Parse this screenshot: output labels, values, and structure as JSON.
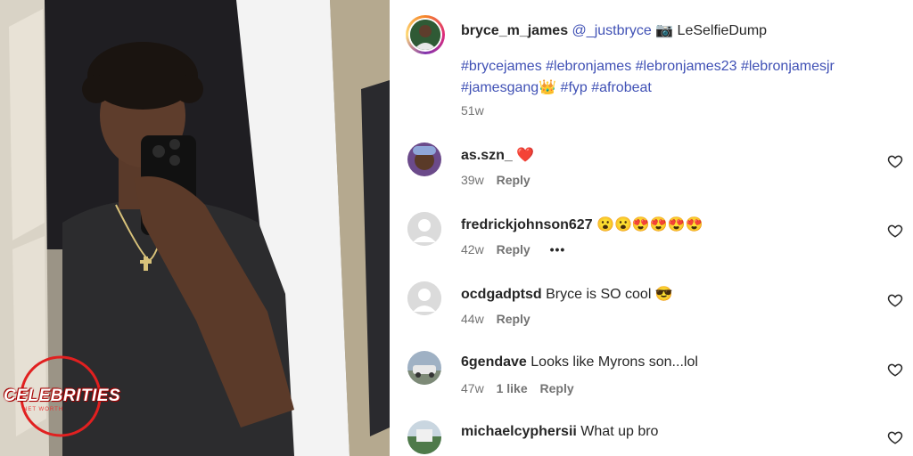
{
  "post": {
    "username": "bryce_m_james",
    "mention": "@_justbryce",
    "camera_emoji": "📷",
    "caption_suffix": "LeSelfieDump",
    "hashtags_line1": "#brycejames #lebronjames #lebronjames23 #lebronjamesjr",
    "hashtags_line2_a": "#jamesgang",
    "crown_emoji": "👑",
    "hashtags_line2_b": "#fyp #afrobeat",
    "age": "51w"
  },
  "watermark": {
    "title": "CELEBRITIES",
    "subtitle": "NET WORTH"
  },
  "comments": [
    {
      "user": "as.szn_",
      "text": "",
      "emoji": "❤️",
      "age": "39w",
      "likes": "",
      "reply": "Reply",
      "more": "",
      "avatar": "photo"
    },
    {
      "user": "fredrickjohnson627",
      "text": "",
      "emoji": "😮😮😍😍😍😍",
      "age": "42w",
      "likes": "",
      "reply": "Reply",
      "more": "•••",
      "avatar": "default"
    },
    {
      "user": "ocdgadptsd",
      "text": "Bryce is SO cool",
      "emoji": "😎",
      "age": "44w",
      "likes": "",
      "reply": "Reply",
      "more": "",
      "avatar": "default"
    },
    {
      "user": "6gendave",
      "text": "Looks like Myrons son...lol",
      "emoji": "",
      "age": "47w",
      "likes": "1 like",
      "reply": "Reply",
      "more": "",
      "avatar": "photo"
    },
    {
      "user": "michaelcyphersii",
      "text": "What up bro",
      "emoji": "",
      "age": "",
      "likes": "",
      "reply": "",
      "more": "",
      "avatar": "photo"
    }
  ],
  "icons": {
    "like": "heart-outline-icon"
  }
}
